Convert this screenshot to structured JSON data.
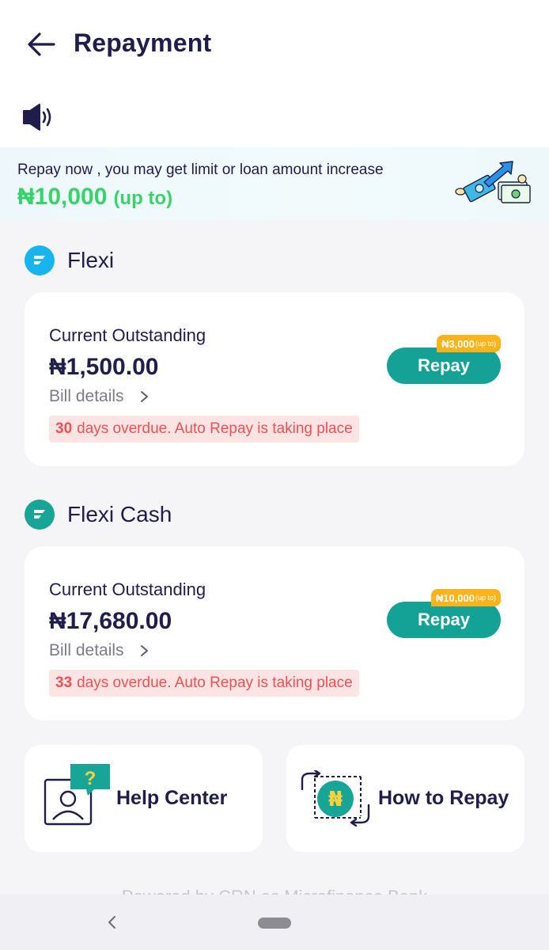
{
  "header": {
    "title": "Repayment"
  },
  "banner": {
    "text": "Repay now , you may get limit or loan amount increase",
    "amount": "₦10,000",
    "amount_suffix": "(up to)"
  },
  "loans": [
    {
      "name": "Flexi",
      "logo_color": "#18b4f0",
      "outstanding_label": "Current Outstanding",
      "amount": "₦1,500.00",
      "bill_details_label": "Bill details",
      "overdue_days": "30",
      "overdue_text": "days overdue. Auto Repay is taking place",
      "repay_label": "Repay",
      "tag_amount": "₦3,000",
      "tag_suffix": "(up to)"
    },
    {
      "name": "Flexi Cash",
      "logo_color": "#17a597",
      "outstanding_label": "Current Outstanding",
      "amount": "₦17,680.00",
      "bill_details_label": "Bill details",
      "overdue_days": "33",
      "overdue_text": "days overdue. Auto Repay is taking place",
      "repay_label": "Repay",
      "tag_amount": "₦10,000",
      "tag_suffix": "(up to)"
    }
  ],
  "tiles": {
    "help_center": "Help Center",
    "how_to_repay": "How to Repay"
  },
  "footer": {
    "powered_by": "Powered by CRN as Microfinance Bank"
  },
  "colors": {
    "accent": "#14a297",
    "tag": "#ffb31a",
    "amount_green": "#36d36a",
    "overdue_red": "#ee5151"
  },
  "icons": {
    "back": "arrow-left-icon",
    "speaker": "speaker-icon",
    "chevron": "chevron-right-icon",
    "help": "help-center-icon",
    "repay": "how-to-repay-icon"
  }
}
